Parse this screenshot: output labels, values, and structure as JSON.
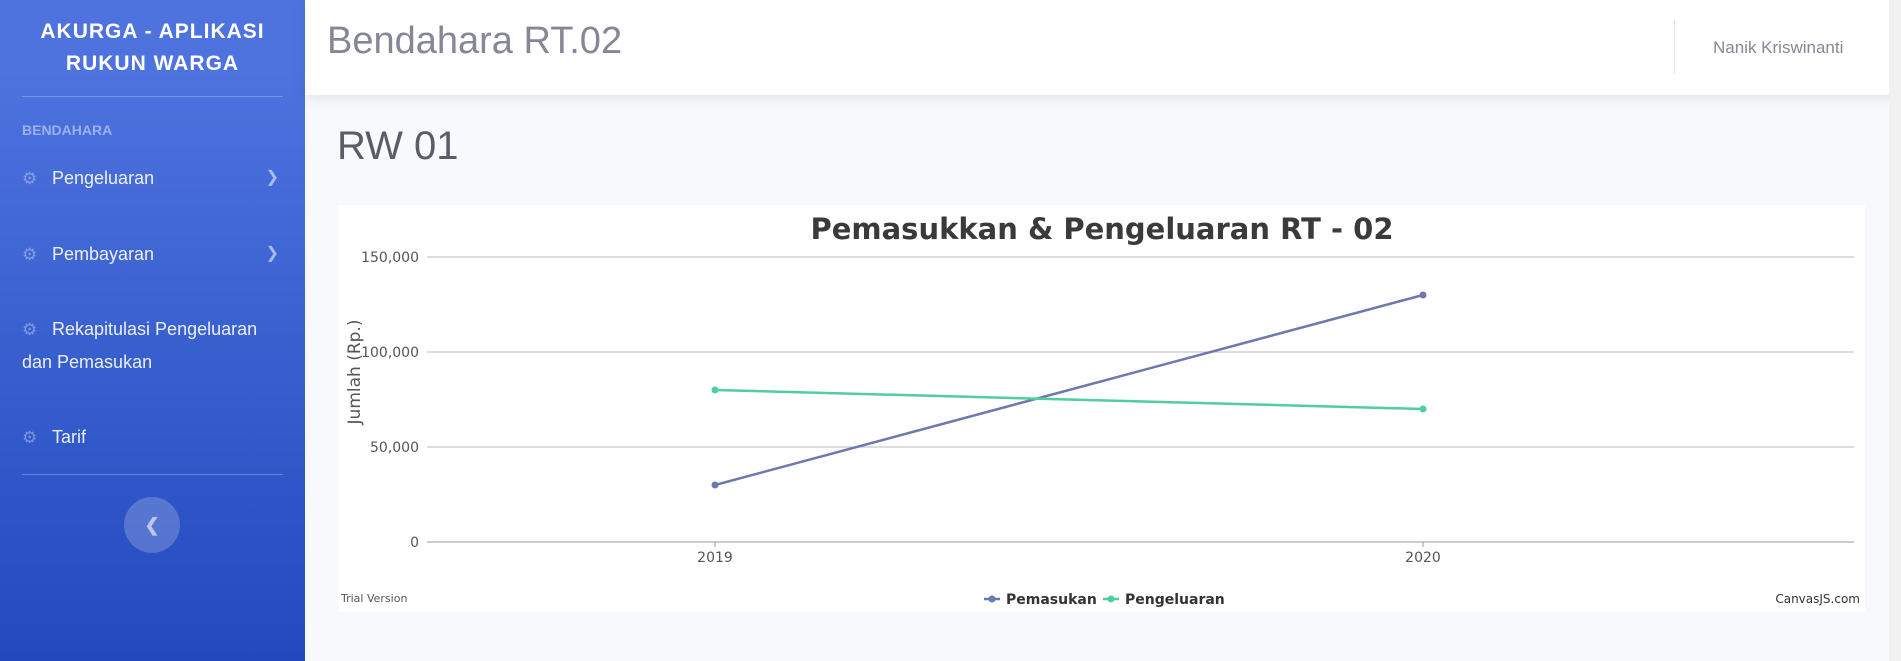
{
  "sidebar": {
    "brand": "AKURGA - APLIKASI RUKUN WARGA",
    "heading": "BENDAHARA",
    "items": [
      {
        "label": "Pengeluaran",
        "icon": "gear-icon",
        "has_submenu": true
      },
      {
        "label": "Pembayaran",
        "icon": "gear-icon",
        "has_submenu": true
      },
      {
        "label": "Rekapitulasi Pengeluaran dan Pemasukan",
        "icon": "gear-icon",
        "has_submenu": false
      },
      {
        "label": "Tarif",
        "icon": "gear-icon",
        "has_submenu": false
      }
    ],
    "toggle_icon": "chevron-left-icon"
  },
  "topbar": {
    "title": "Bendahara RT.02",
    "user": "Nanik Kriswinanti"
  },
  "main": {
    "section_title": "RW 01"
  },
  "chart_data": {
    "type": "line",
    "title": "Pemasukkan & Pengeluaran RT - 02",
    "ylabel": "Jumlah (Rp.)",
    "xlabel": "",
    "categories": [
      "2019",
      "2020"
    ],
    "ylim": [
      0,
      150000
    ],
    "yticks": [
      "0",
      "50,000",
      "100,000",
      "150,000"
    ],
    "grid": true,
    "legend_position": "bottom-center",
    "series": [
      {
        "name": "Pemasukan",
        "values": [
          30000,
          130000
        ],
        "color": "#6d78ad"
      },
      {
        "name": "Pengeluaran",
        "values": [
          80000,
          70000
        ],
        "color": "#51cda0"
      }
    ],
    "watermark_left": "Trial Version",
    "watermark_right": "CanvasJS.com"
  }
}
